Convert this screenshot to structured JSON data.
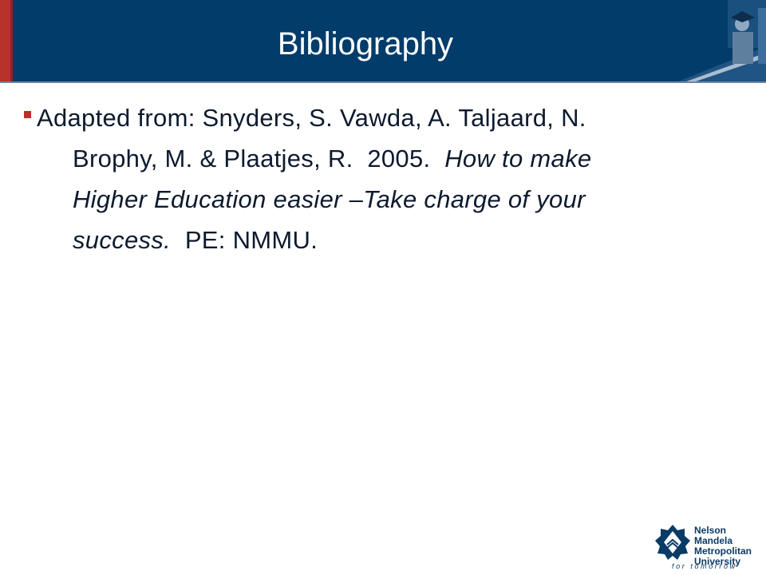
{
  "slide": {
    "title": "Bibliography",
    "bullet": {
      "line1": "Adapted from: Snyders, S. Vawda, A. Taljaard, N.",
      "line2_plain": "Brophy, M. & Plaatjes, R.  2005.  ",
      "line2_italic": "How to make",
      "line3_italic": "Higher Education easier –Take charge of your",
      "line4_italic": "success.",
      "line4_plain": "  PE: NMMU."
    }
  },
  "logo": {
    "line1": "Nelson Mandela",
    "line2": "Metropolitan",
    "line3": "University",
    "tagline": "for tomorrow"
  },
  "colors": {
    "header": "#023c6a",
    "accent_red": "#b8312b",
    "text": "#0d1a2e"
  }
}
